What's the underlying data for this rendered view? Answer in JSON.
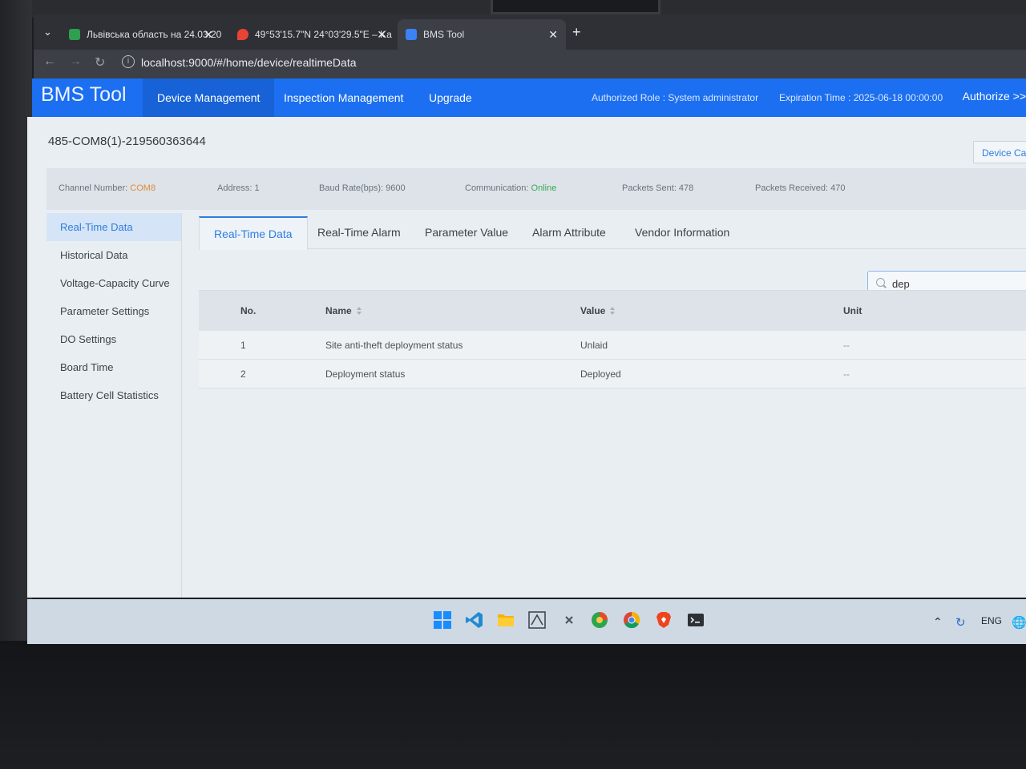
{
  "browser": {
    "tabs": [
      {
        "title": "Львівська область на 24.03.20",
        "icon": "sheets-icon",
        "color": "#2e9e4f"
      },
      {
        "title": "49°53'15.7\"N 24°03'29.5\"E – Ka",
        "icon": "maps-pin-icon",
        "color": "#ea4335"
      },
      {
        "title": "BMS Tool",
        "icon": "wrench-icon",
        "color": "#3b82f6"
      }
    ],
    "active_tab": 2,
    "url": "localhost:9000/#/home/device/realtimeData"
  },
  "header": {
    "logo": "BMS Tool",
    "menu": [
      "Device Management",
      "Inspection Management",
      "Upgrade"
    ],
    "active_menu": 0,
    "role": "Authorized Role : System administrator",
    "expiration": "Expiration Time : 2025-06-18 00:00:00",
    "authorize": "Authorize >>",
    "accent_color": "#1b6ff0"
  },
  "device": {
    "title": "485-COM8(1)-219560363644",
    "catalog_button": "Device Catalog",
    "info": {
      "channel_label": "Channel Number: ",
      "channel_value": "COM8",
      "address": "Address: 1",
      "baud": "Baud Rate(bps): 9600",
      "comm_label": "Communication: ",
      "comm_value": "Online",
      "sent": "Packets Sent: 478",
      "received": "Packets Received: 470"
    }
  },
  "sidebar": {
    "items": [
      "Real-Time Data",
      "Historical Data",
      "Voltage-Capacity Curve",
      "Parameter Settings",
      "DO Settings",
      "Board Time",
      "Battery Cell Statistics"
    ],
    "active": 0
  },
  "tabs": {
    "items": [
      "Real-Time Data",
      "Real-Time Alarm",
      "Parameter Value",
      "Alarm Attribute",
      "Vendor Information"
    ],
    "active": 0
  },
  "search": {
    "value": "dep"
  },
  "table": {
    "headers": {
      "no": "No.",
      "name": "Name",
      "value": "Value",
      "unit": "Unit"
    },
    "rows": [
      {
        "no": "1",
        "name": "Site anti-theft deployment status",
        "value": "Unlaid",
        "unit": "--"
      },
      {
        "no": "2",
        "name": "Deployment status",
        "value": "Deployed",
        "unit": "--"
      }
    ]
  },
  "taskbar": {
    "apps": [
      "windows-start-icon",
      "vscode-icon",
      "file-explorer-icon",
      "air-app-icon",
      "tool-icon",
      "green-browser-icon",
      "chrome-icon",
      "brave-icon",
      "terminal-icon"
    ],
    "tray_lang": "ENG"
  }
}
